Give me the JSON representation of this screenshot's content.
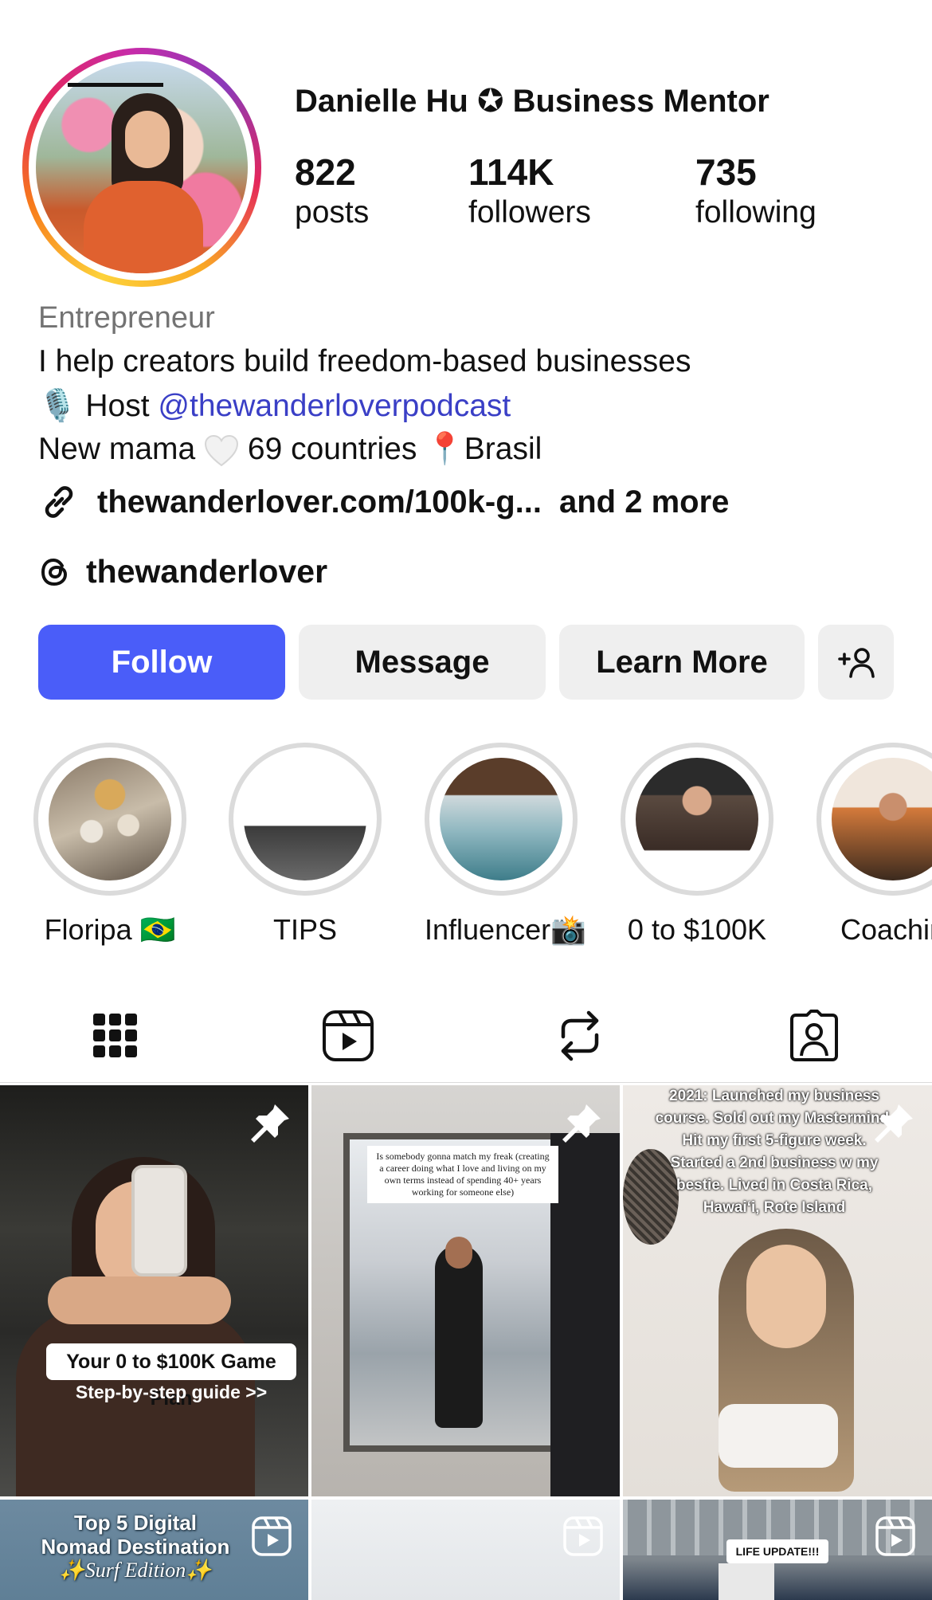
{
  "profile": {
    "name": "Danielle Hu ✪ Business Mentor",
    "stats": [
      {
        "value": "822",
        "label": "posts"
      },
      {
        "value": "114K",
        "label": "followers"
      },
      {
        "value": "735",
        "label": "following"
      }
    ],
    "category": "Entrepreneur",
    "bio_line1": "I help creators build freedom-based businesses",
    "bio_line2_prefix": "🎙️ Host ",
    "bio_line2_mention": "@thewanderloverpodcast",
    "bio_line3_a": "New mama ",
    "bio_line3_b": " 69 countries ",
    "bio_line3_pin": "📍",
    "bio_line3_c": "Brasil",
    "link_text": "thewanderlover.com/100k-g...",
    "link_more": "and 2 more",
    "threads_handle": "thewanderlover"
  },
  "buttons": {
    "follow": "Follow",
    "message": "Message",
    "learn_more": "Learn More"
  },
  "highlights": [
    {
      "label": "Floripa 🇧🇷"
    },
    {
      "label": "TIPS"
    },
    {
      "label": "Influencer📸"
    },
    {
      "label": "0 to $100K"
    },
    {
      "label": "Coachin"
    }
  ],
  "tabs": [
    "grid-icon",
    "reels-icon",
    "reposts-icon",
    "tagged-icon"
  ],
  "posts": {
    "post1_title": "Your 0 to $100K Game Plan",
    "post1_sub": "Step-by-step guide >>",
    "post2_text": "Is somebody gonna match my freak (creating a career doing what I love and living on my own terms instead of spending 40+ years working for someone else)",
    "post3_text": "2021: Launched my business course. Sold out my Mastermind. Hit my first 5-figure week. Started a 2nd business w my bestie. Lived in Costa Rica, Hawai‘i, Rote Island",
    "post4_line1": "Top 5 Digital",
    "post4_line2": "Nomad Destination",
    "post4_line3": "✨Surf Edition✨",
    "post6_text": "LIFE UPDATE!!!"
  },
  "colors": {
    "accent": "#4a5df9",
    "mention": "#3a3fc6",
    "secondary_button": "#efefef"
  }
}
